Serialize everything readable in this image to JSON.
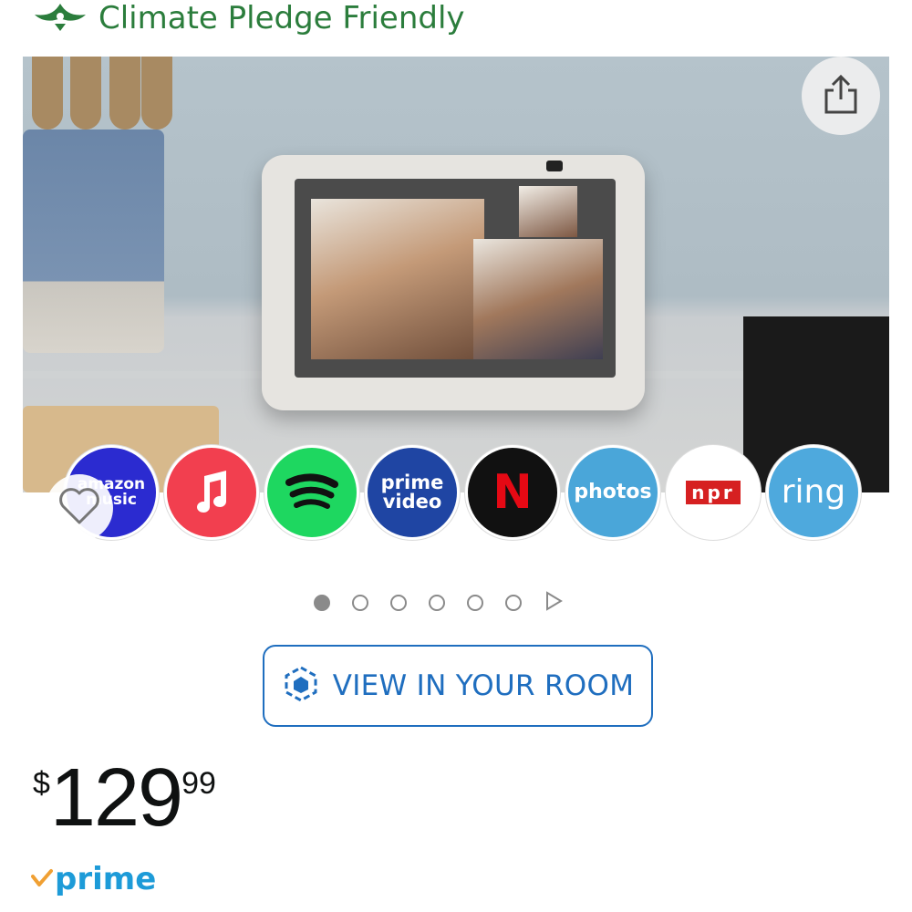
{
  "badge": {
    "label": "Climate Pledge Friendly"
  },
  "hero": {
    "share_icon": "share-icon",
    "wishlist_icon": "heart-icon"
  },
  "apps": [
    {
      "label": "amazon music",
      "color": "#2b2bd0"
    },
    {
      "label": "",
      "color": "#f23f4f"
    },
    {
      "label": "",
      "color": "#1ed760"
    },
    {
      "label": "prime video",
      "color": "#1f45a3"
    },
    {
      "label": "N",
      "color": "#111111"
    },
    {
      "label": "photos",
      "color": "#4aa6d9"
    },
    {
      "label": "npr",
      "color": "#ffffff"
    },
    {
      "label": "ring",
      "color": "#4ea9dd"
    }
  ],
  "carousel": {
    "total": 6,
    "active": 1
  },
  "view_room": {
    "label": "VIEW IN YOUR ROOM",
    "icon": "ar-cube-icon"
  },
  "price": {
    "symbol": "$",
    "whole": "129",
    "fraction": "99"
  },
  "prime": {
    "label": "prime",
    "icon": "prime-check-icon"
  },
  "colors": {
    "accent": "#1f6ebf",
    "climate_green": "#2b7d3c",
    "prime_blue": "#1d9bd8",
    "prime_orange": "#f0a033"
  }
}
